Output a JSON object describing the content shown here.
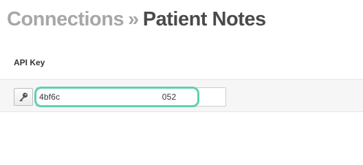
{
  "header": {
    "parent": "Connections",
    "separator": "»",
    "current": "Patient Notes"
  },
  "form": {
    "api_key": {
      "label": "API Key",
      "value": "4bf6c                                          052",
      "icon": "key-icon"
    }
  },
  "colors": {
    "highlight": "#5fcfb1",
    "title_muted": "#a7a7a7",
    "title_current": "#4a4a4a",
    "row_background": "#f6f6f6"
  }
}
